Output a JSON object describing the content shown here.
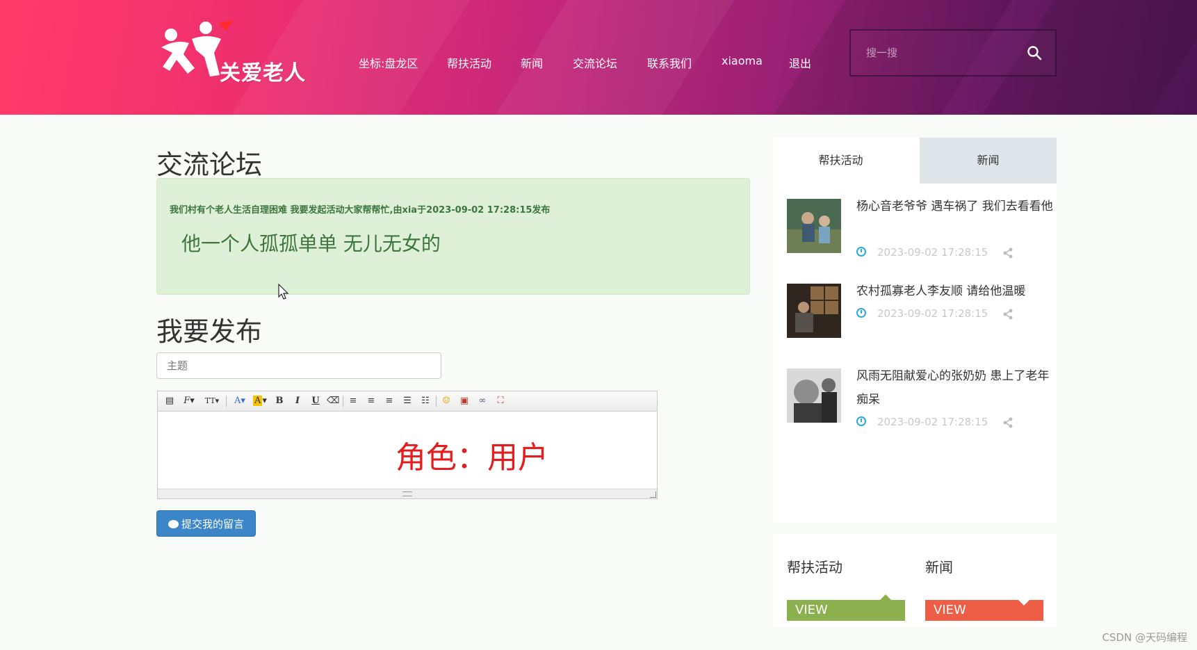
{
  "header": {
    "logo_text": "关爱老人",
    "nav": [
      {
        "label": "坐标:盘龙区"
      },
      {
        "label": "帮扶活动"
      },
      {
        "label": "新闻"
      },
      {
        "label": "交流论坛"
      },
      {
        "label": "联系我们"
      },
      {
        "label": "xiaoma"
      },
      {
        "label": "退出"
      }
    ],
    "search_placeholder": "搜一搜"
  },
  "forum": {
    "title": "交流论坛",
    "post_meta": "我们村有个老人生活自理困难 我要发起活动大家帮帮忙,由xia于2023-09-02 17:28:15发布",
    "post_body": "他一个人孤孤单单 无儿无女的"
  },
  "publish": {
    "title": "我要发布",
    "subject_placeholder": "主题",
    "editor_content": "角色：用户",
    "submit_label": "提交我的留言"
  },
  "sidebar": {
    "tabs": [
      {
        "label": "帮扶活动"
      },
      {
        "label": "新闻"
      }
    ],
    "items": [
      {
        "title": "杨心音老爷爷 遇车祸了 我们去看看他",
        "date": "2023-09-02 17:28:15"
      },
      {
        "title": "农村孤寡老人李友顺 请给他温暖",
        "date": "2023-09-02 17:28:15"
      },
      {
        "title": "风雨无阻献爱心的张奶奶 患上了老年痴呆",
        "date": "2023-09-02 17:28:15"
      }
    ]
  },
  "view_links": [
    {
      "label": "帮扶活动",
      "button": "VIEW",
      "color": "#8db04f"
    },
    {
      "label": "新闻",
      "button": "VIEW",
      "color": "#ee5e46"
    }
  ],
  "watermark": "CSDN @天码编程"
}
